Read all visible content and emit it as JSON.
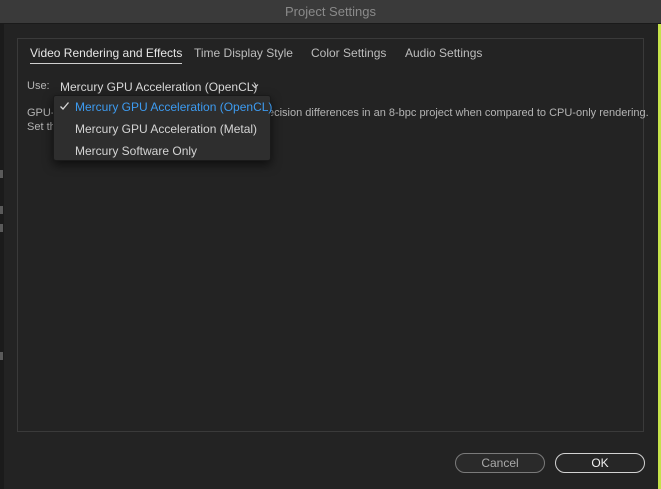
{
  "window": {
    "title": "Project Settings"
  },
  "tabs": [
    {
      "label": "Video Rendering and Effects",
      "active": true
    },
    {
      "label": "Time Display Style",
      "active": false
    },
    {
      "label": "Color Settings",
      "active": false
    },
    {
      "label": "Audio Settings",
      "active": false
    }
  ],
  "renderer": {
    "use_label": "Use:",
    "selected_value": "Mercury GPU Acceleration (OpenCL)",
    "options": [
      {
        "label": "Mercury GPU Acceleration (OpenCL)",
        "selected": true
      },
      {
        "label": "Mercury GPU Acceleration (Metal)",
        "selected": false
      },
      {
        "label": "Mercury Software Only",
        "selected": false
      }
    ]
  },
  "description": {
    "line1_start": "GPU-a",
    "line1_end": "ecision differences in an 8-bpc project when compared to CPU-only rendering.",
    "line2_start": "Set th"
  },
  "buttons": {
    "cancel": "Cancel",
    "ok": "OK"
  },
  "colors": {
    "accent": "#3d9bf0",
    "background": "#232323",
    "desktop": "#c6e24a"
  },
  "icons": {
    "dropdown": "chevron-down-icon",
    "selected": "checkmark-icon"
  }
}
